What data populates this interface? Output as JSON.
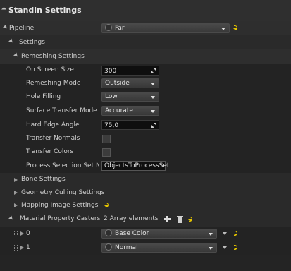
{
  "panel": {
    "title": "Standin Settings"
  },
  "pipeline": {
    "label": "Pipeline",
    "value": "Far"
  },
  "settings": {
    "label": "Settings"
  },
  "remeshing": {
    "label": "Remeshing Settings"
  },
  "fields": {
    "on_screen_size": {
      "label": "On Screen Size",
      "value": "300"
    },
    "remeshing_mode": {
      "label": "Remeshing Mode",
      "value": "Outside"
    },
    "hole_filling": {
      "label": "Hole Filling",
      "value": "Low"
    },
    "surface_transfer_mode": {
      "label": "Surface Transfer Mode",
      "value": "Accurate"
    },
    "hard_edge_angle": {
      "label": "Hard Edge Angle",
      "value": "75,0"
    },
    "transfer_normals": {
      "label": "Transfer Normals",
      "checked": false
    },
    "transfer_colors": {
      "label": "Transfer Colors",
      "checked": false
    },
    "process_selection_set_name": {
      "label": "Process Selection Set Nam",
      "value": "ObjectsToProcessSet"
    }
  },
  "groups": {
    "bone_settings": "Bone Settings",
    "geometry_culling": "Geometry Culling Settings",
    "mapping_image": "Mapping Image Settings"
  },
  "material_casters": {
    "label": "Material Property Casters",
    "count_text": "2 Array elements",
    "items": [
      {
        "index": "0",
        "value": "Base Color"
      },
      {
        "index": "1",
        "value": "Normal"
      }
    ]
  },
  "colors": {
    "reset_yellow": "#e3c300",
    "panel_bg": "#242424"
  },
  "icons": [
    "reset-icon",
    "plus-icon",
    "trash-icon",
    "spin-icon",
    "caret-icon"
  ]
}
